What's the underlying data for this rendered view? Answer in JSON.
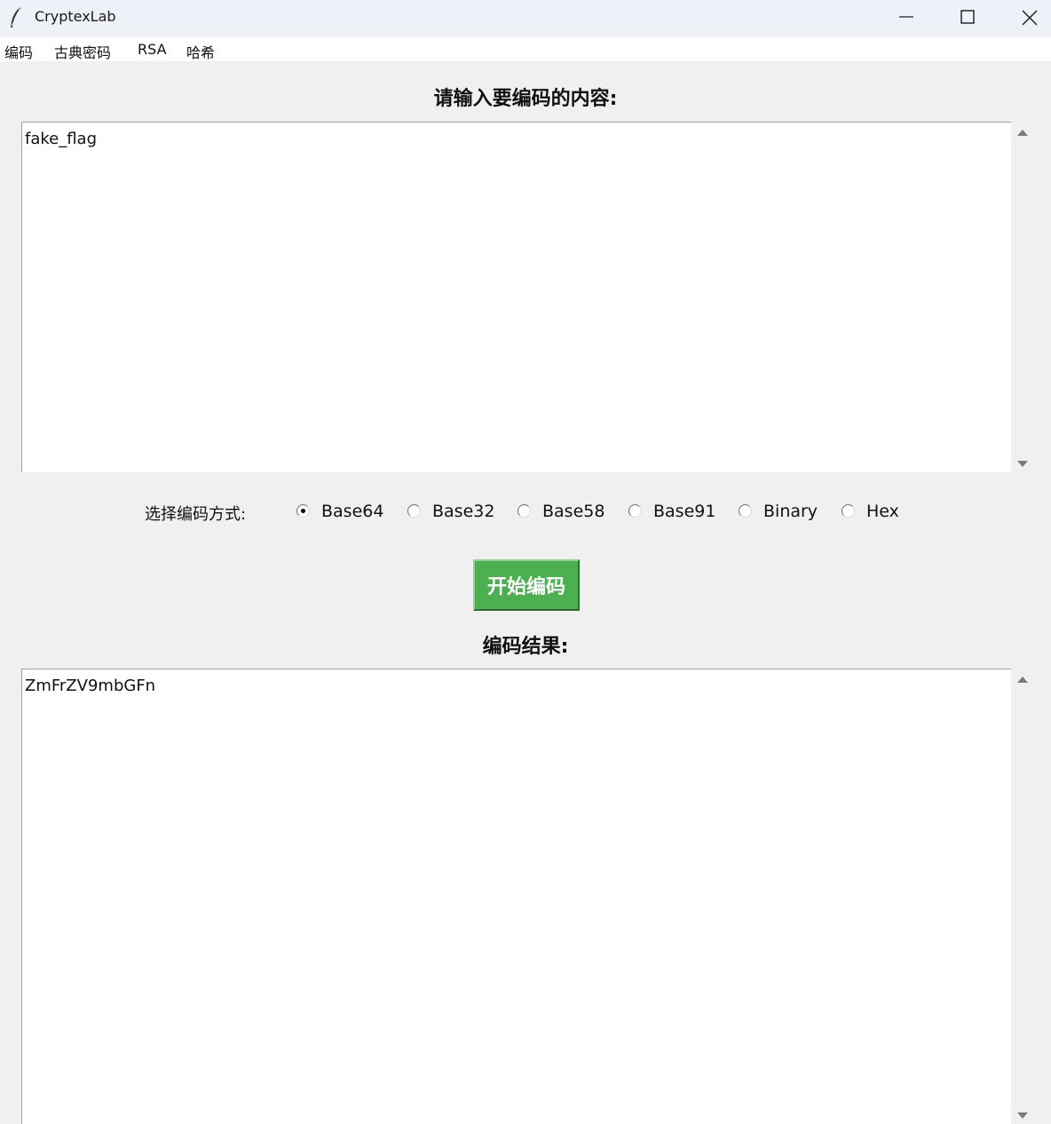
{
  "window": {
    "title": "CryptexLab",
    "controls": {
      "minimize": "minimize-icon",
      "maximize": "maximize-icon",
      "close": "close-icon"
    }
  },
  "menubar": {
    "items": [
      "编码",
      "古典密码",
      "RSA",
      "哈希"
    ]
  },
  "input_section": {
    "heading": "请输入要编码的内容:",
    "value": "fake_flag"
  },
  "encoding_options": {
    "label": "选择编码方式:",
    "options": [
      "Base64",
      "Base32",
      "Base58",
      "Base91",
      "Binary",
      "Hex"
    ],
    "selected": "Base64"
  },
  "start_button": {
    "label": "开始编码",
    "color": "#4caf50"
  },
  "output_section": {
    "heading": "编码结果:",
    "value": "ZmFrZV9mbGFn"
  }
}
